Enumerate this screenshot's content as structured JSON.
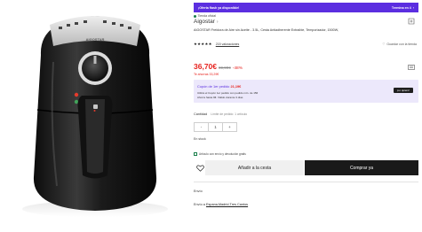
{
  "product_image": {
    "brand_label": "AIGOSTAR"
  },
  "flash": {
    "left": "¡Oferta flash ya disponible!",
    "right": "Termina en 4"
  },
  "store": {
    "label": "Tienda oficial"
  },
  "brand": {
    "name": "Aigostar"
  },
  "title": "AIGOSTAR Freidora de Aire sin Aceite - 3.5L, Cesta Antiadherente Extraíble, Temporizador, 1500W,",
  "rating": {
    "stars": "★★★★★",
    "reviews": "215 valoraciones",
    "wishlist": "Guardar con la tienda"
  },
  "price": {
    "current": "36,70€",
    "original": "69,99€",
    "discount": "-48%",
    "savings": "Te ahorras 33,29€"
  },
  "coupon": {
    "title_prefix": "Cupón de 1er pedido",
    "title_amount": "21,19€",
    "line1": "Utiliza el Cupón 1er pedido con pedido mín. de 15€",
    "line2": "Ahorra hasta 9€. Válido durante 3 días",
    "button": "¡Lo quiero!"
  },
  "quantity": {
    "label": "Cantidad",
    "limit": "Límite de pedido: 1 artículo",
    "minus": "-",
    "value": "1",
    "plus": "+",
    "stock": "En stock"
  },
  "shipping_note": "Artículo con envío y devolución gratis",
  "actions": {
    "add_to_cart": "Añadir a la cesta",
    "buy_now": "Comprar ya"
  },
  "envio": {
    "title": "Envío",
    "prefix": "Envío a",
    "location": "Espana,Madrid,Tres Cantos"
  },
  "colors": {
    "accent": "#5b2ee0",
    "price_red": "#e7231f",
    "button_dark": "#1a1a1a"
  }
}
